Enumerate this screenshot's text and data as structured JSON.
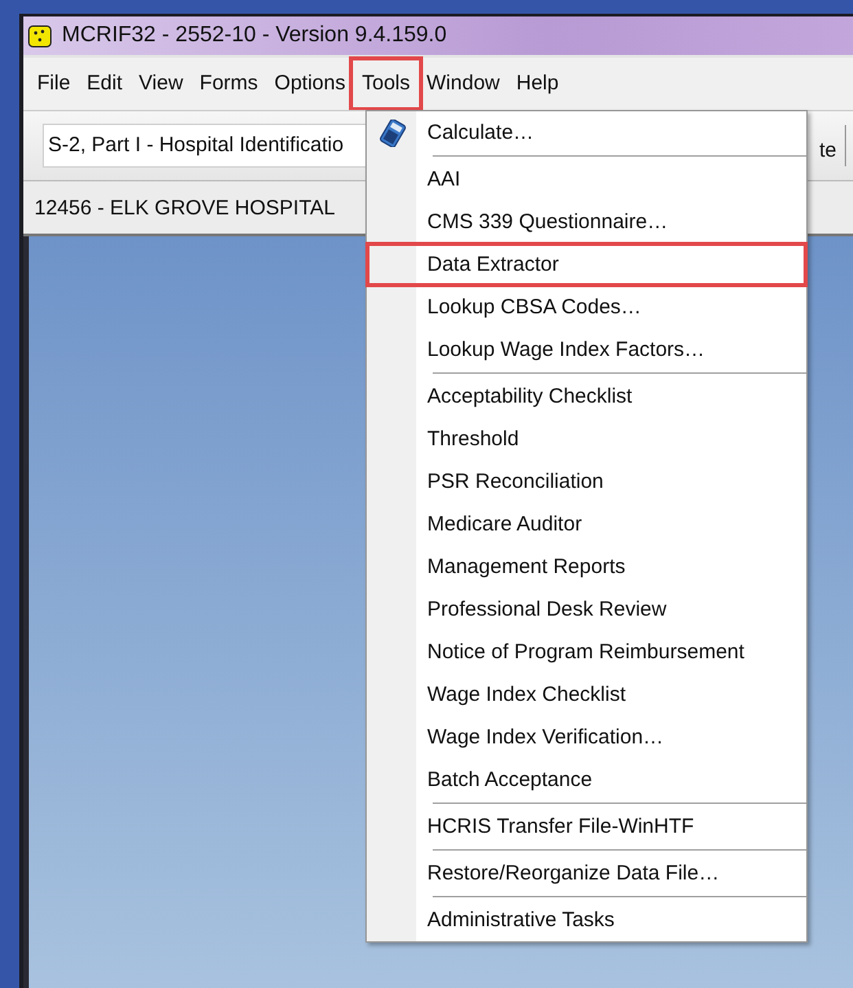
{
  "window": {
    "title": "MCRIF32 - 2552-10 - Version 9.4.159.0"
  },
  "menu_bar": [
    {
      "label": "File",
      "highlighted": false
    },
    {
      "label": "Edit",
      "highlighted": false
    },
    {
      "label": "View",
      "highlighted": false
    },
    {
      "label": "Forms",
      "highlighted": false
    },
    {
      "label": "Options",
      "highlighted": false
    },
    {
      "label": "Tools",
      "highlighted": true
    },
    {
      "label": "Window",
      "highlighted": false
    },
    {
      "label": "Help",
      "highlighted": false
    }
  ],
  "toolbar": {
    "form_select": {
      "value": "S-2, Part I - Hospital Identificatio"
    },
    "button_partial": "te"
  },
  "hospital_label": "12456 - ELK GROVE HOSPITAL",
  "tools_menu": [
    {
      "kind": "icon_item",
      "label": "Calculate…",
      "highlighted": false
    },
    {
      "kind": "separator"
    },
    {
      "kind": "item",
      "label": "AAI",
      "highlighted": false
    },
    {
      "kind": "item",
      "label": "CMS 339 Questionnaire…",
      "highlighted": false
    },
    {
      "kind": "item",
      "label": "Data Extractor",
      "highlighted": true
    },
    {
      "kind": "item",
      "label": "Lookup CBSA Codes…",
      "highlighted": false
    },
    {
      "kind": "item",
      "label": "Lookup Wage Index Factors…",
      "highlighted": false
    },
    {
      "kind": "separator"
    },
    {
      "kind": "item",
      "label": "Acceptability Checklist",
      "highlighted": false
    },
    {
      "kind": "item",
      "label": "Threshold",
      "highlighted": false
    },
    {
      "kind": "item",
      "label": "PSR Reconciliation",
      "highlighted": false
    },
    {
      "kind": "item",
      "label": "Medicare Auditor",
      "highlighted": false
    },
    {
      "kind": "item",
      "label": "Management Reports",
      "highlighted": false
    },
    {
      "kind": "item",
      "label": "Professional Desk Review",
      "highlighted": false
    },
    {
      "kind": "item",
      "label": "Notice of Program Reimbursement",
      "highlighted": false
    },
    {
      "kind": "item",
      "label": "Wage Index Checklist",
      "highlighted": false
    },
    {
      "kind": "item",
      "label": "Wage Index Verification…",
      "highlighted": false
    },
    {
      "kind": "item",
      "label": "Batch Acceptance",
      "highlighted": false
    },
    {
      "kind": "separator"
    },
    {
      "kind": "item",
      "label": "HCRIS Transfer File-WinHTF",
      "highlighted": false
    },
    {
      "kind": "separator"
    },
    {
      "kind": "item",
      "label": "Restore/Reorganize Data File…",
      "highlighted": false
    },
    {
      "kind": "separator"
    },
    {
      "kind": "item",
      "label": "Administrative Tasks",
      "highlighted": false
    }
  ]
}
